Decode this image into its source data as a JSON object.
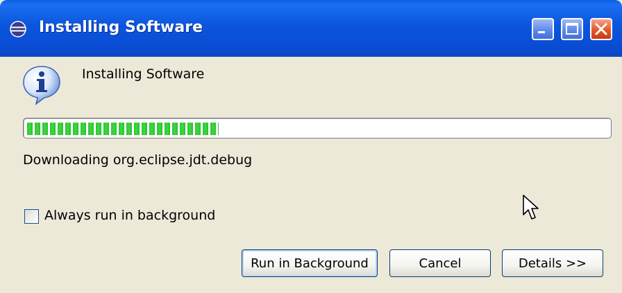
{
  "window": {
    "title": "Installing Software",
    "title_icon": "eclipse-icon",
    "controls": [
      "minimize-icon",
      "maximize-icon",
      "close-icon"
    ]
  },
  "dialog": {
    "icon": "info-icon",
    "message": "Installing Software",
    "progress": {
      "value_percent": 33,
      "color": "#2ec431"
    },
    "status": "Downloading org.eclipse.jdt.debug",
    "checkbox": {
      "label": "Always run in background",
      "checked": false
    },
    "buttons": {
      "run_in_background": "Run in Background",
      "cancel": "Cancel",
      "details": "Details >>"
    }
  },
  "colors": {
    "titlebar": "#0b55dd",
    "dialog_background": "#ece9d8",
    "close_button": "#e4572d"
  }
}
